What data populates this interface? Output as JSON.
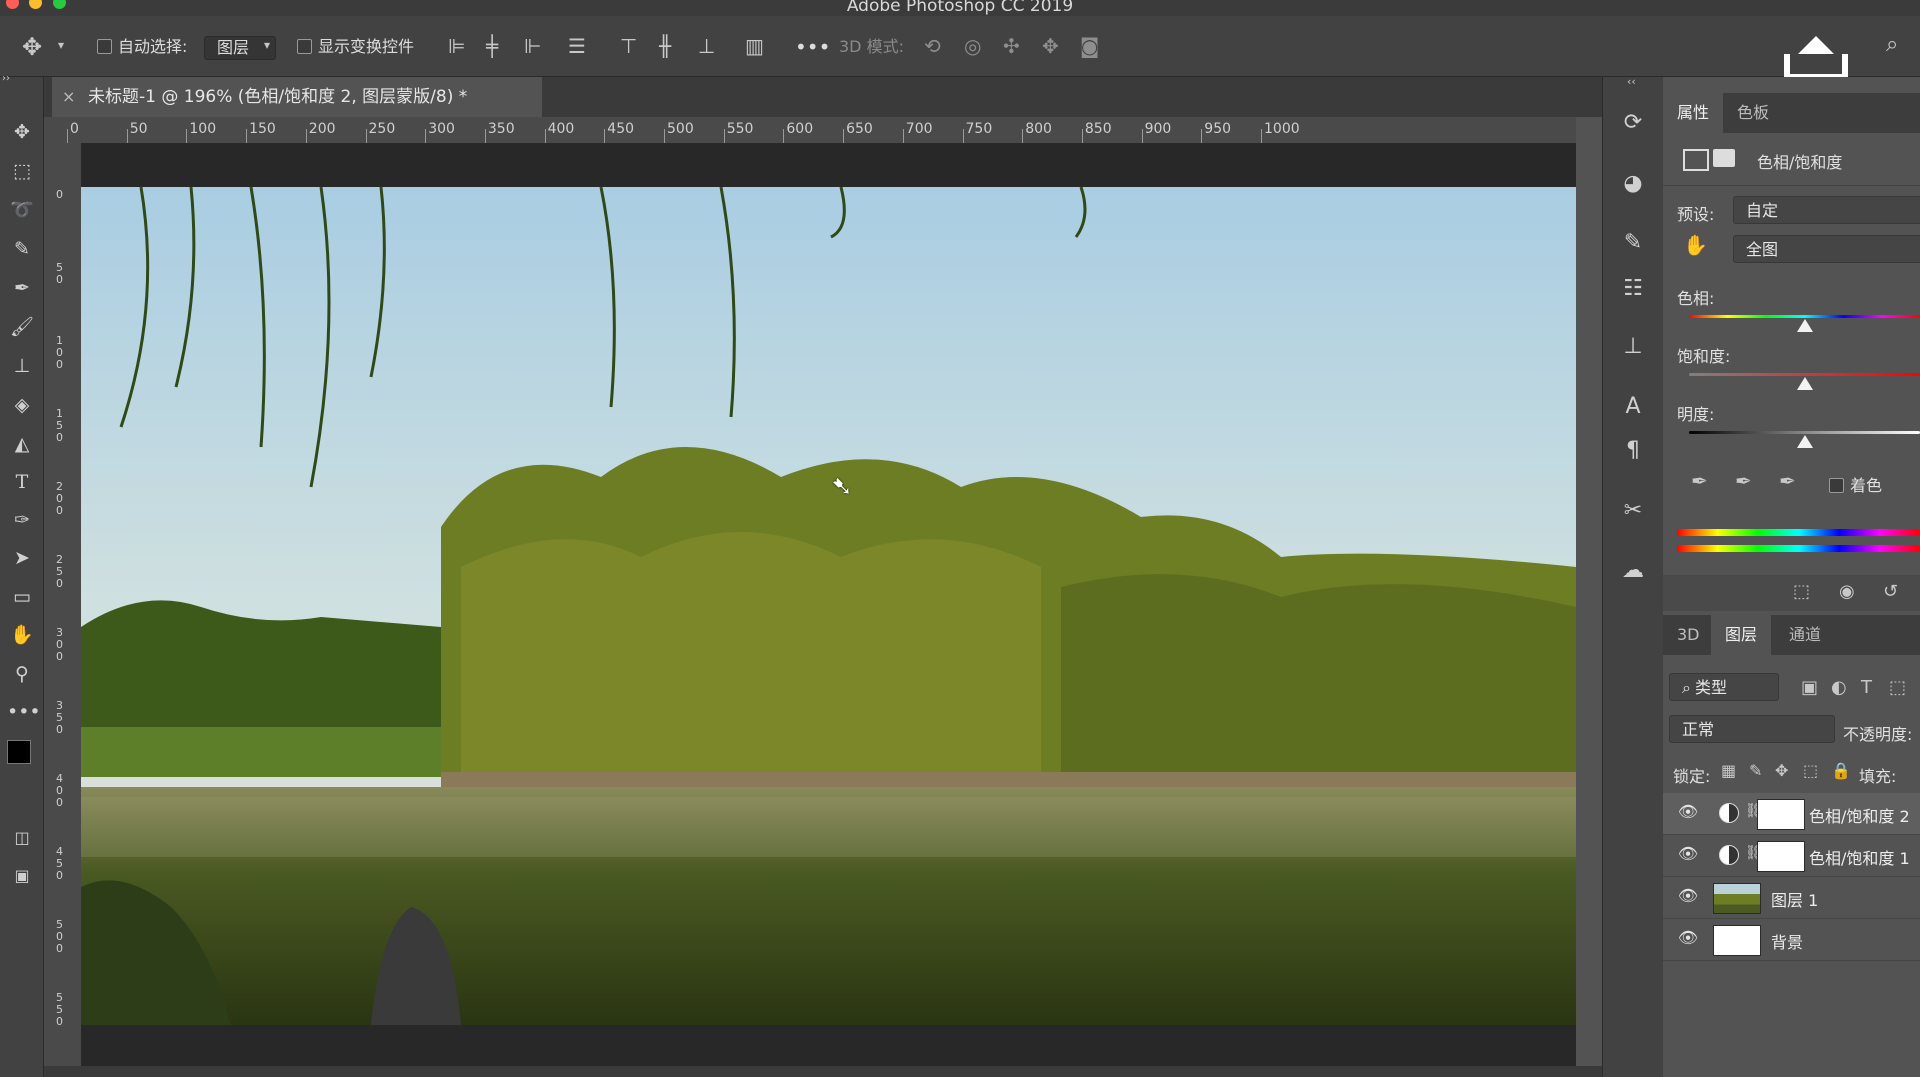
{
  "app": {
    "title": "Adobe Photoshop CC 2019"
  },
  "options_bar": {
    "auto_select_label": "自动选择:",
    "auto_select_value": "图层",
    "show_transform_label": "显示变换控件",
    "more": "•••",
    "mode3d_label": "3D 模式:"
  },
  "document": {
    "tab_title": "未标题-1 @ 196% (色相/饱和度 2, 图层蒙版/8) *",
    "close": "×"
  },
  "ruler_h": [
    "0",
    "50",
    "100",
    "150",
    "200",
    "250",
    "300",
    "350",
    "400",
    "450",
    "500",
    "550",
    "600",
    "650",
    "700",
    "750",
    "800",
    "850",
    "900",
    "950",
    "1000"
  ],
  "ruler_v": [
    {
      "label": "0"
    },
    {
      "label": "5\n0"
    },
    {
      "label": "1\n0\n0"
    },
    {
      "label": "1\n5\n0"
    },
    {
      "label": "2\n0\n0"
    },
    {
      "label": "2\n5\n0"
    },
    {
      "label": "3\n0\n0"
    },
    {
      "label": "3\n5\n0"
    },
    {
      "label": "4\n0\n0"
    },
    {
      "label": "4\n5\n0"
    },
    {
      "label": "5\n0\n0"
    },
    {
      "label": "5\n5\n0"
    }
  ],
  "properties": {
    "tab_properties": "属性",
    "tab_swatches": "色板",
    "adjustment_title": "色相/饱和度",
    "preset_label": "预设:",
    "preset_value": "自定",
    "range_value": "全图",
    "hue_label": "色相:",
    "saturation_label": "饱和度:",
    "lightness_label": "明度:",
    "colorize_label": "着色",
    "hue": 0,
    "saturation": 0,
    "lightness": 0
  },
  "layers_panel": {
    "tab_3d": "3D",
    "tab_layers": "图层",
    "tab_channels": "通道",
    "filter_label": "类型",
    "blend_mode": "正常",
    "opacity_label": "不透明度:",
    "lock_label": "锁定:",
    "fill_label": "填充:",
    "layers": [
      {
        "name": "色相/饱和度 2",
        "type": "adjustment"
      },
      {
        "name": "色相/饱和度 1",
        "type": "adjustment"
      },
      {
        "name": "图层 1",
        "type": "image"
      },
      {
        "name": "背景",
        "type": "background"
      }
    ]
  },
  "colors": {
    "foreground": "#000000",
    "background": "#ffffff",
    "panel": "#535353",
    "toolbar": "#424242"
  },
  "icons": {
    "move": "move-tool-icon",
    "marquee": "marquee-tool-icon",
    "lasso": "lasso-tool-icon",
    "quick_select": "quick-select-icon",
    "eyedropper": "eyedropper-icon",
    "brush": "brush-icon",
    "stamp": "stamp-icon",
    "eraser": "eraser-icon",
    "paint_bucket": "paint-bucket-icon",
    "type": "type-tool-icon",
    "pen": "pen-icon",
    "path_select": "path-select-icon",
    "shape": "shape-icon",
    "hand": "hand-icon",
    "zoom": "zoom-icon"
  }
}
